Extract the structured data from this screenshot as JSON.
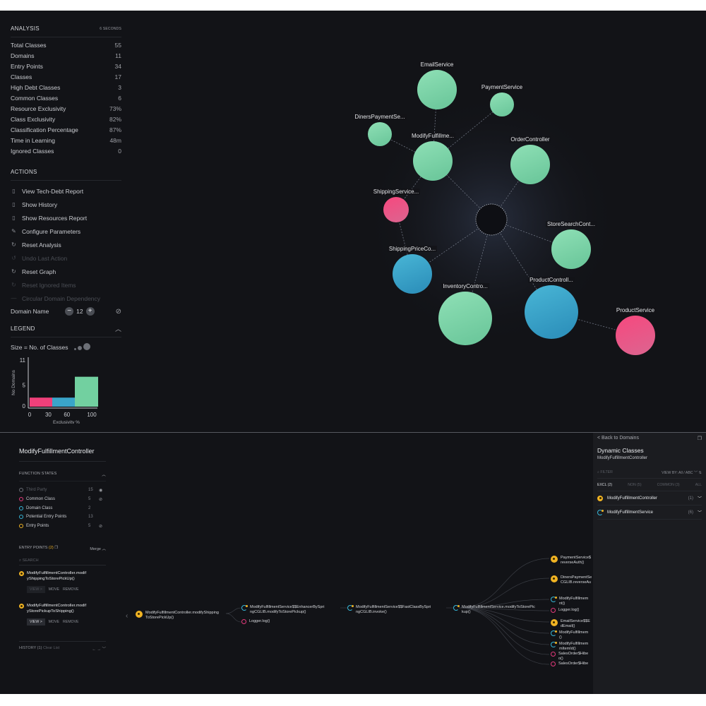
{
  "analysis": {
    "title": "ANALYSIS",
    "elapsed": "6 SECONDS",
    "stats": [
      {
        "label": "Total Classes",
        "value": "55"
      },
      {
        "label": "Domains",
        "value": "11"
      },
      {
        "label": "Entry Points",
        "value": "34"
      },
      {
        "label": "Classes",
        "value": "17"
      },
      {
        "label": "High Debt Classes",
        "value": "3"
      },
      {
        "label": "Common Classes",
        "value": "6"
      },
      {
        "label": "Resource Exclusivity",
        "value": "73%"
      },
      {
        "label": "Class Exclusivity",
        "value": "82%"
      },
      {
        "label": "Classification Percentage",
        "value": "87%"
      },
      {
        "label": "Time in Learning",
        "value": "48m"
      },
      {
        "label": "Ignored Classes",
        "value": "0"
      }
    ]
  },
  "actions": {
    "title": "ACTIONS",
    "items": [
      {
        "label": "View Tech-Debt Report",
        "icon": "document-icon",
        "glyph": "▯",
        "enabled": true
      },
      {
        "label": "Show History",
        "icon": "document-icon",
        "glyph": "▯",
        "enabled": true
      },
      {
        "label": "Show Resources Report",
        "icon": "document-icon",
        "glyph": "▯",
        "enabled": true
      },
      {
        "label": "Configure Parameters",
        "icon": "pencil-icon",
        "glyph": "✎",
        "enabled": true
      },
      {
        "label": "Reset Analysis",
        "icon": "reset-icon",
        "glyph": "↻",
        "enabled": true
      },
      {
        "label": "Undo Last Action",
        "icon": "undo-icon",
        "glyph": "↺",
        "enabled": false
      },
      {
        "label": "Reset Graph",
        "icon": "reset-icon",
        "glyph": "↻",
        "enabled": true
      },
      {
        "label": "Reset Ignored Items",
        "icon": "reset-icon",
        "glyph": "↻",
        "enabled": false
      },
      {
        "label": "Circular Domain Dependency",
        "icon": "dash-icon",
        "glyph": "—",
        "enabled": false
      }
    ],
    "domain_name_label": "Domain Name",
    "domain_name_value": "12",
    "minus": "−",
    "plus": "+"
  },
  "legend": {
    "title": "LEGEND",
    "size_label": "Size = No. of Classes",
    "histogram": {
      "type": "bar",
      "ylabel": "No Domains",
      "xlabel": "Exclusivity %",
      "x_ticks": [
        "0",
        "30",
        "60",
        "100"
      ],
      "y_ticks": [
        "0",
        "5",
        "11"
      ],
      "ylim": [
        0,
        11
      ],
      "bins": [
        {
          "range": "0-30",
          "value": 2,
          "color": "#f0407a"
        },
        {
          "range": "30-60",
          "value": 2,
          "color": "#3aa4c9"
        },
        {
          "range": "60-100",
          "value": 7,
          "color": "#72d0a0"
        }
      ]
    }
  },
  "graph": {
    "colors": {
      "high": "#7fd6a8",
      "mid": "#3aa3c8",
      "low": "#f0407a"
    },
    "nodes": [
      {
        "label": "EmailService",
        "class_level": "high"
      },
      {
        "label": "PaymentService",
        "class_level": "high"
      },
      {
        "label": "DinersPaymentSe...",
        "class_level": "high"
      },
      {
        "label": "ModifyFulfillme...",
        "class_level": "high"
      },
      {
        "label": "OrderController",
        "class_level": "high"
      },
      {
        "label": "ShippingService...",
        "class_level": "low"
      },
      {
        "label": "StoreSearchCont...",
        "class_level": "high"
      },
      {
        "label": "ShippingPriceCo...",
        "class_level": "mid"
      },
      {
        "label": "InventoryContro...",
        "class_level": "high"
      },
      {
        "label": "ProductControll...",
        "class_level": "mid"
      },
      {
        "label": "ProductService",
        "class_level": "low"
      }
    ]
  },
  "detail": {
    "title": "ModifyFulfillmentController",
    "function_states": {
      "title": "FUNCTION STATES",
      "items": [
        {
          "label": "Third Party",
          "count": "15",
          "color": "#6b6e75",
          "dim": true,
          "eye": "◉"
        },
        {
          "label": "Common Class",
          "count": "5",
          "color": "#e2397a",
          "dim": false,
          "eye": "⊘"
        },
        {
          "label": "Domain Class",
          "count": "2",
          "color": "#36b5d6",
          "dim": false,
          "eye": ""
        },
        {
          "label": "Potential Entry Points",
          "count": "13",
          "color": "#36b5d6",
          "dim": false,
          "eye": ""
        },
        {
          "label": "Entry Points",
          "count": "5",
          "color": "#f0b323",
          "dim": false,
          "eye": "⊘"
        }
      ]
    },
    "entry_points": {
      "title": "ENTRY POINTS",
      "count": "(2)",
      "merge": "Merge",
      "search_placeholder": "SEARCH",
      "items": [
        {
          "name": "ModifyFulfillmentController.modif\nyShippingToStorePickUp()",
          "view": "VIEW >",
          "move": "MOVE",
          "remove": "REMOVE",
          "view_active": false
        },
        {
          "name": "ModifyFulfillmentController.modif\nyStorePickupToShipping()",
          "view": "VIEW >",
          "move": "MOVE",
          "remove": "REMOVE",
          "view_active": true
        }
      ]
    },
    "history": {
      "title": "HISTORY (1)",
      "clear": "Clear List"
    }
  },
  "flow": {
    "nodes": [
      {
        "text": "ModifyFulfillmentController.modifyShipping\nToStorePickUp()",
        "kind": "pin"
      },
      {
        "text": "ModifyFulfillmentService$$EnhancerBySpri\nngCGLIB.modifyToStorePickup()",
        "kind": "pot"
      },
      {
        "text": "Logger.log()",
        "kind": "ring"
      },
      {
        "text": "ModifyFulfillmentService$$FastClassBySpri\nngCGLIB.invoke()",
        "kind": "pot"
      },
      {
        "text": "ModifyFulfillmentService.modifyToStorePic\nkup()",
        "kind": "pot"
      },
      {
        "text": "PaymentService$\nreverseAuth()",
        "kind": "pin"
      },
      {
        "text": "DinersPaymentSe\nCGLIB.reverseAu",
        "kind": "pin"
      },
      {
        "text": "ModifyFulfillmem\nnt()",
        "kind": "pot"
      },
      {
        "text": "Logger.log()",
        "kind": "ring"
      },
      {
        "text": "EmailService$$E\ndEmail()",
        "kind": "pin"
      },
      {
        "text": "ModifyFulfillmem\n()",
        "kind": "pot"
      },
      {
        "text": "ModifyFulfillmem\nmItemId()",
        "kind": "pot"
      },
      {
        "text": "SalesOrder$Hibe\no()",
        "kind": "ring"
      },
      {
        "text": "SalesOrder$Hibe",
        "kind": "ring"
      }
    ]
  },
  "right_panel": {
    "back": "< Back to Domains",
    "title": "Dynamic Classes",
    "subtitle": "ModifyFulfillmentController",
    "filter_placeholder": "FILTER",
    "view_by": "VIEW BY:  All / ABC",
    "tabs": [
      "EXCL (2)",
      "NON (5)",
      "COMMON (3)",
      "ALL"
    ],
    "rows": [
      {
        "name": "ModifyFulfillmentController",
        "count": "(1)",
        "kind": "pin"
      },
      {
        "name": "ModifyFulfillmentService",
        "count": "(6)",
        "kind": "pot"
      }
    ]
  }
}
